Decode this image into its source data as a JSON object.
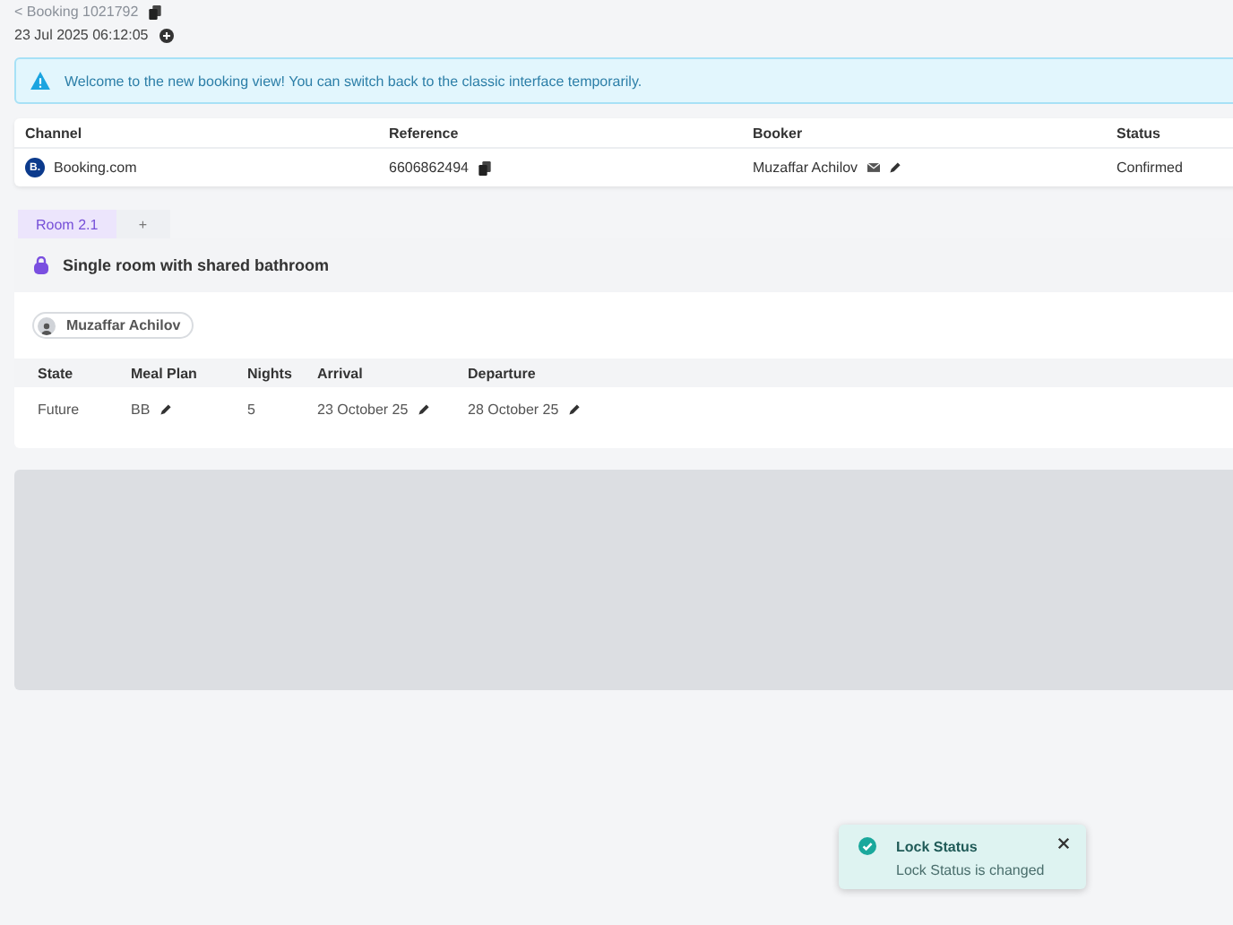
{
  "header": {
    "back_link": "< Booking 1021792",
    "created": "23 Jul 2025 06:12:05"
  },
  "notice": {
    "text": "Welcome to the new booking view! You can switch back to the classic interface temporarily."
  },
  "booking_table": {
    "columns": [
      "Channel",
      "Reference",
      "Booker",
      "Status"
    ],
    "row": {
      "channel": "Booking.com",
      "channel_logo": "B.",
      "reference": "6606862494",
      "booker": "Muzaffar Achilov",
      "status": "Confirmed"
    }
  },
  "room_tabs": [
    {
      "label": "Room 2.1",
      "selected": true
    },
    {
      "label": "+",
      "selected": false
    }
  ],
  "room": {
    "title": "Single room with shared bathroom",
    "guest": "Muzaffar Achilov",
    "columns": [
      "State",
      "Meal Plan",
      "Nights",
      "Arrival",
      "Departure"
    ],
    "row": {
      "state": "Future",
      "meal_plan": "BB",
      "nights": "5",
      "arrival": "23 October 25",
      "departure": "28 October 25"
    }
  },
  "toast": {
    "title": "Lock Status",
    "message": "Lock Status is changed"
  }
}
